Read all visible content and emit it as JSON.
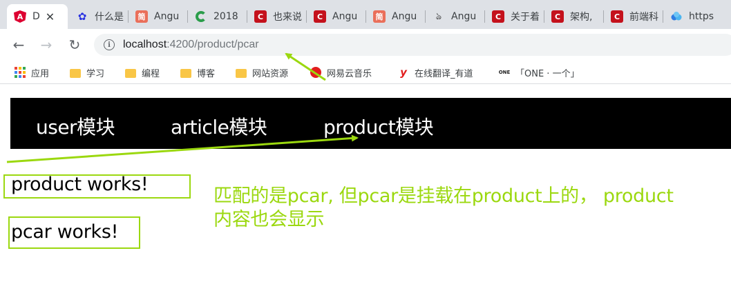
{
  "tabs": [
    {
      "title": "D",
      "icon": "angular-icon",
      "active": true
    },
    {
      "title": "什么是",
      "icon": "baidu-paw-icon"
    },
    {
      "title": "Angu",
      "icon": "jianshu-icon"
    },
    {
      "title": "2018",
      "icon": "green-c-icon"
    },
    {
      "title": "也来说",
      "icon": "csdn-icon"
    },
    {
      "title": "Angu",
      "icon": "csdn-icon"
    },
    {
      "title": "Angu",
      "icon": "jianshu-icon"
    },
    {
      "title": "Angu",
      "icon": "feather-icon"
    },
    {
      "title": "关于着",
      "icon": "csdn-icon"
    },
    {
      "title": "架构,",
      "icon": "csdn-icon"
    },
    {
      "title": "前端科",
      "icon": "csdn-icon"
    },
    {
      "title": "https",
      "icon": "cloud-icon"
    }
  ],
  "tab_close": "✕",
  "toolbar": {
    "back": "←",
    "forward": "→",
    "reload": "↻",
    "info_glyph": "i",
    "url_host": "localhost",
    "url_rest": ":4200/product/pcar"
  },
  "bookmarks": [
    {
      "label": "应用",
      "icon": "apps-grid-icon"
    },
    {
      "label": "学习",
      "icon": "folder-icon"
    },
    {
      "label": "编程",
      "icon": "folder-icon"
    },
    {
      "label": "博客",
      "icon": "folder-icon"
    },
    {
      "label": "网站资源",
      "icon": "folder-icon"
    },
    {
      "label": "网易云音乐",
      "icon": "netease-music-icon"
    },
    {
      "label": "在线翻译_有道",
      "icon": "youdao-icon"
    },
    {
      "label": "「ONE · 一个」",
      "icon": "one-icon"
    }
  ],
  "bookmark_glyphs": {
    "youdao": "y",
    "one": "ONE"
  },
  "app": {
    "nav": [
      "user模块",
      "article模块",
      "product模块"
    ],
    "product_works": "product works!",
    "pcar_works": "pcar works!"
  },
  "annotation": {
    "line1": "匹配的是pcar, 但pcar是挂载在product上的， product",
    "line2": "内容也会显示",
    "color": "#9bd80f"
  },
  "colors": {
    "tabstrip": "#dee1e6",
    "nav_bg": "#000000",
    "csdn_red": "#c4111c",
    "angular_red": "#dd0031"
  }
}
